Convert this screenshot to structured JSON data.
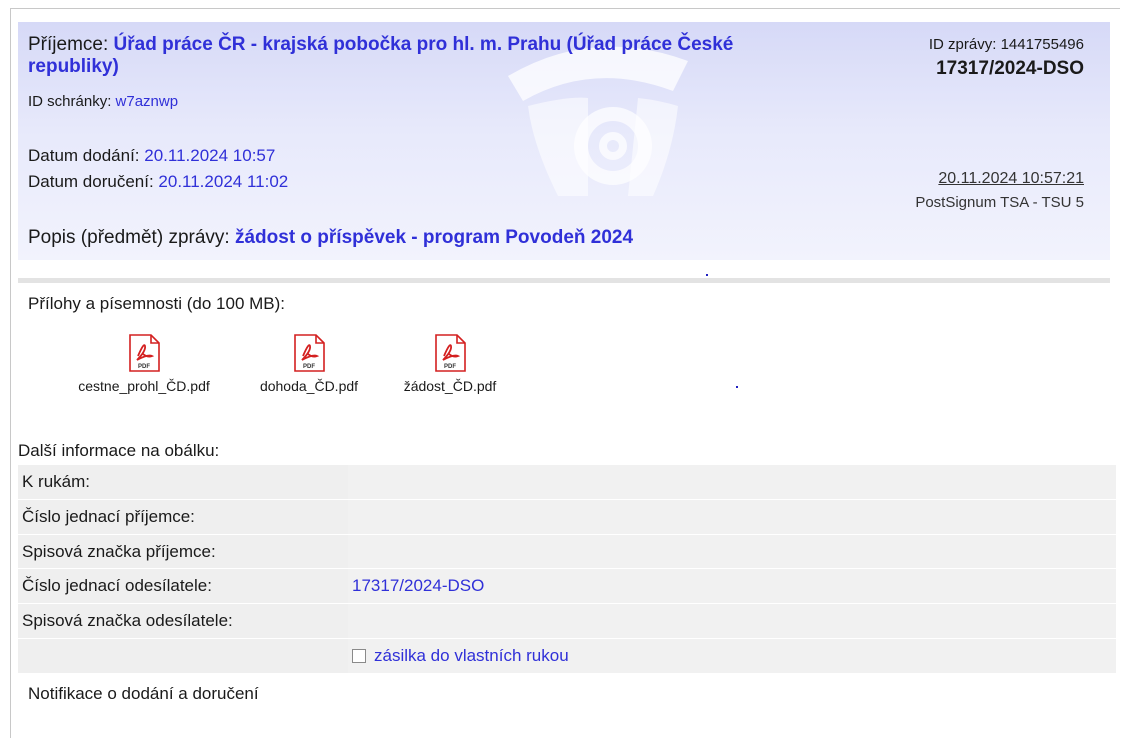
{
  "header": {
    "recipient_label": "Příjemce: ",
    "recipient_value": "Úřad práce ČR - krajská pobočka pro hl. m. Prahu (Úřad práce České republiky)",
    "box_id_label": "ID schránky: ",
    "box_id_value": "w7aznwp",
    "message_id_label": "ID zprávy: ",
    "message_id_value": "1441755496",
    "case_number": "17317/2024-DSO",
    "delivery_date_label": "Datum dodání: ",
    "delivery_date_value": "20.11.2024 10:57",
    "receipt_date_label": "Datum doručení: ",
    "receipt_date_value": "20.11.2024 11:02",
    "timestamp": "20.11.2024 10:57:21",
    "timestamp_authority": "PostSignum TSA - TSU 5",
    "subject_label": "Popis (předmět) zprávy: ",
    "subject_value": "žádost o příspěvek - program Povodeň 2024"
  },
  "attachments": {
    "label": "Přílohy a písemnosti (do 100 MB):",
    "icon_text": "PDF",
    "files": [
      {
        "name": "cestne_prohl_ČD.pdf",
        "icon": "pdf-icon"
      },
      {
        "name": "dohoda_ČD.pdf",
        "icon": "pdf-icon"
      },
      {
        "name": "žádost_ČD.pdf",
        "icon": "pdf-icon"
      }
    ]
  },
  "envelope": {
    "title": "Další informace na obálku:",
    "rows": [
      {
        "label": "K rukám:",
        "value": ""
      },
      {
        "label": "Číslo jednací příjemce:",
        "value": ""
      },
      {
        "label": "Spisová značka příjemce:",
        "value": ""
      },
      {
        "label": "Číslo jednací odesílatele:",
        "value": "17317/2024-DSO"
      },
      {
        "label": "Spisová značka odesílatele:",
        "value": ""
      }
    ],
    "personal_delivery_label": "zásilka do vlastních rukou",
    "personal_delivery_checked": false
  },
  "notifications": {
    "label": "Notifikace o dodání a doručení"
  },
  "colors": {
    "accent_blue": "#3030d8",
    "header_bg": "#d6d9f7",
    "pdf_red": "#d42020"
  }
}
